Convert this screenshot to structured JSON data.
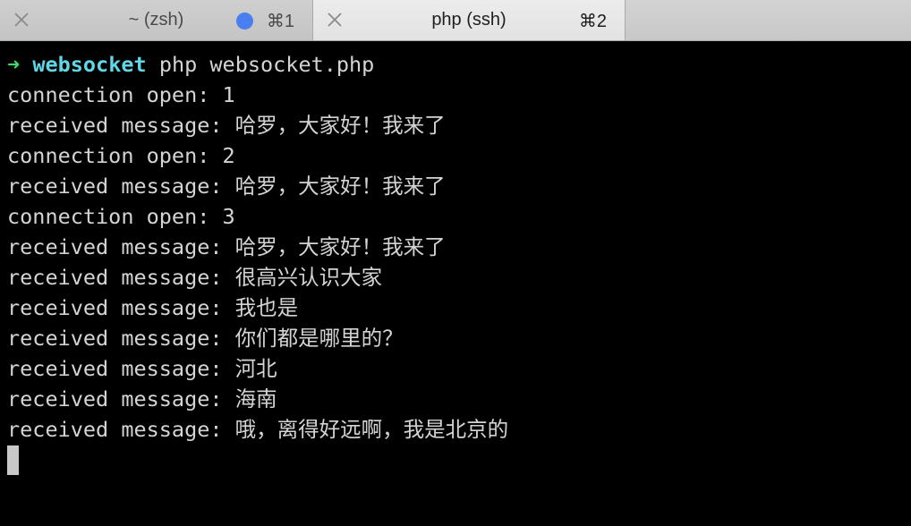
{
  "tabs": [
    {
      "title": "~ (zsh)",
      "shortcut": "⌘1",
      "active": false,
      "has_activity_dot": true
    },
    {
      "title": "php (ssh)",
      "shortcut": "⌘2",
      "active": true,
      "has_activity_dot": false
    }
  ],
  "prompt": {
    "arrow": "➜",
    "directory": "websocket",
    "command": "php websocket.php"
  },
  "output_lines": [
    "connection open: 1",
    "received message: 哈罗，大家好！我来了",
    "connection open: 2",
    "received message: 哈罗，大家好！我来了",
    "connection open: 3",
    "received message: 哈罗，大家好！我来了",
    "received message: 很高兴认识大家",
    "received message: 我也是",
    "received message: 你们都是哪里的？",
    "received message: 河北",
    "received message: 海南",
    "received message: 哦，离得好远啊，我是北京的"
  ],
  "colors": {
    "background": "#000000",
    "text": "#d4d4d4",
    "prompt_arrow": "#3fd96a",
    "prompt_directory": "#5fd7e6",
    "activity_dot": "#4a7ff0"
  }
}
